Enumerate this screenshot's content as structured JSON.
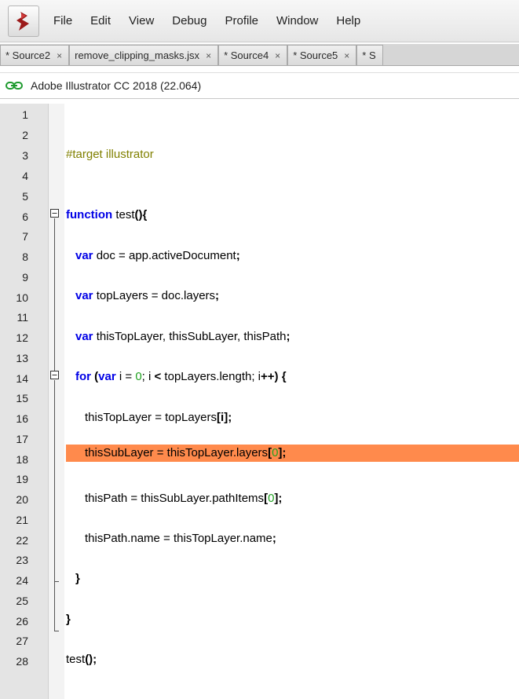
{
  "app": {
    "logo": "adobe-extendscript-logo"
  },
  "menu": [
    "File",
    "Edit",
    "View",
    "Debug",
    "Profile",
    "Window",
    "Help"
  ],
  "tabs": [
    {
      "label": "* Source2",
      "close": "×"
    },
    {
      "label": "remove_clipping_masks.jsx",
      "close": "×"
    },
    {
      "label": "* Source4",
      "close": "×"
    },
    {
      "label": "* Source5",
      "close": "×"
    },
    {
      "label": "* S",
      "close": ""
    }
  ],
  "target": {
    "icon": "link-icon",
    "label": "Adobe Illustrator CC 2018 (22.064)"
  },
  "editor": {
    "line_numbers": [
      "1",
      "2",
      "3",
      "4",
      "5",
      "6",
      "7",
      "8",
      "9",
      "10",
      "11",
      "12",
      "13",
      "14",
      "15",
      "16",
      "17",
      "18",
      "19",
      "20",
      "21",
      "22",
      "23",
      "24",
      "25",
      "26",
      "27",
      "28"
    ],
    "highlighted_line": 18,
    "highlight_color": "#ff8a4c",
    "code": {
      "l3": "#target illustrator",
      "l6_kw": "function",
      "l6_name": " test",
      "l6_punc": "(){",
      "l8_kw": "var",
      "l8_rest": " doc = app.activeDocument",
      "l10_kw": "var",
      "l10_rest": " topLayers = doc.layers",
      "l12_kw": "var",
      "l12_rest": " thisTopLayer, thisSubLayer, thisPath",
      "semi": ";",
      "l14_kw": "for",
      "l14_var": "var",
      "l14_a": " i = ",
      "l14_zero": "0",
      "l14_b": "; i ",
      "l14_lt": "<",
      "l14_c": " topLayers.length; i",
      "l14_inc": "++",
      "l14_close": ") {",
      "l16": "thisTopLayer = topLayers",
      "l16_idx": "[i];",
      "l18": "thisSubLayer = thisTopLayer.layers",
      "l18_open": "[",
      "l18_zero": "0",
      "l18_close": "];",
      "l20": "thisPath = thisSubLayer.pathItems",
      "l20_open": "[",
      "l20_zero": "0",
      "l20_close": "];",
      "l22": "thisPath.name = thisTopLayer.name",
      "l24": "}",
      "l26": "}",
      "l28_name": "test",
      "l28_punc": "();"
    }
  }
}
